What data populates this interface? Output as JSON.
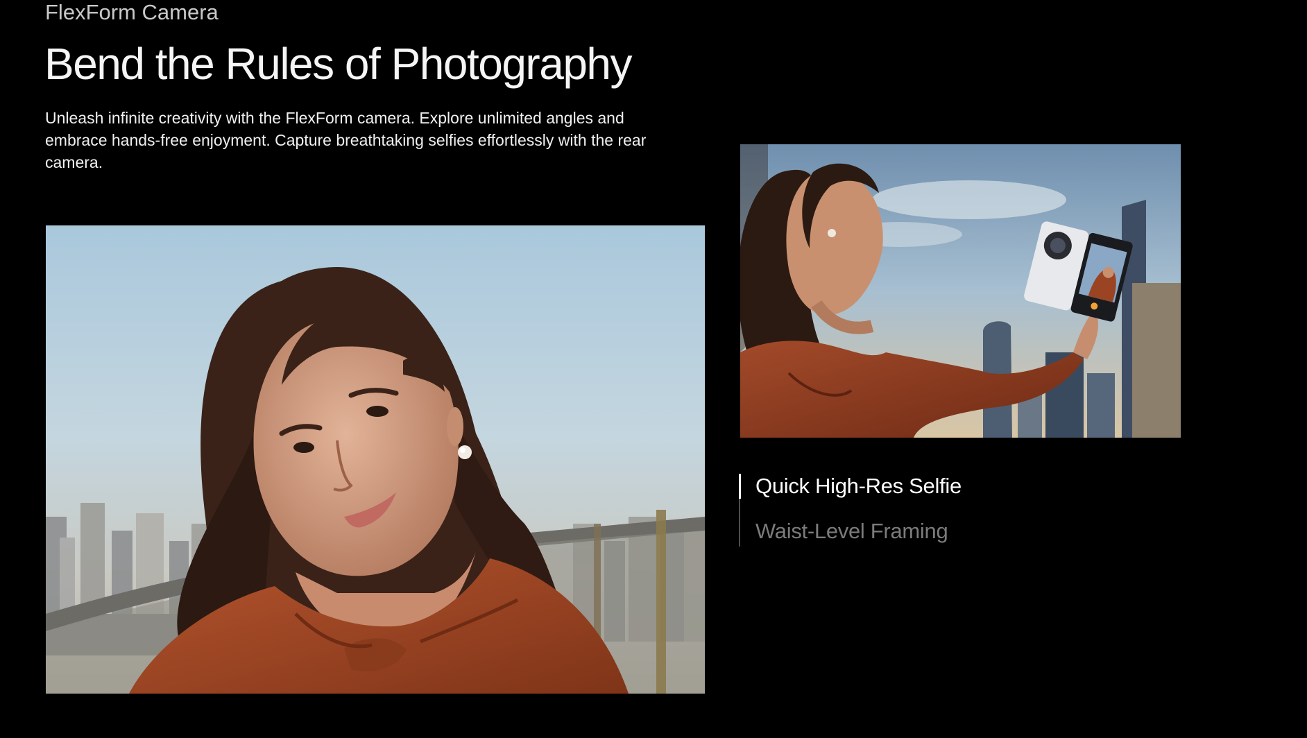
{
  "section": {
    "eyebrow": "FlexForm Camera",
    "headline": "Bend the Rules of Photography",
    "description": "Unleash infinite creativity with the FlexForm camera. Explore unlimited angles and embrace hands-free enjoyment. Capture breathtaking selfies effortlessly with the rear camera."
  },
  "features": {
    "tabs": [
      {
        "label": "Quick High-Res Selfie",
        "state": "active"
      },
      {
        "label": "Waist-Level Framing",
        "state": "inactive"
      }
    ]
  },
  "colors": {
    "background": "#000000",
    "text_primary": "#ffffff",
    "text_muted": "#7b7b7b",
    "indicator": "#ffffff",
    "divider": "#4d4d4d"
  }
}
